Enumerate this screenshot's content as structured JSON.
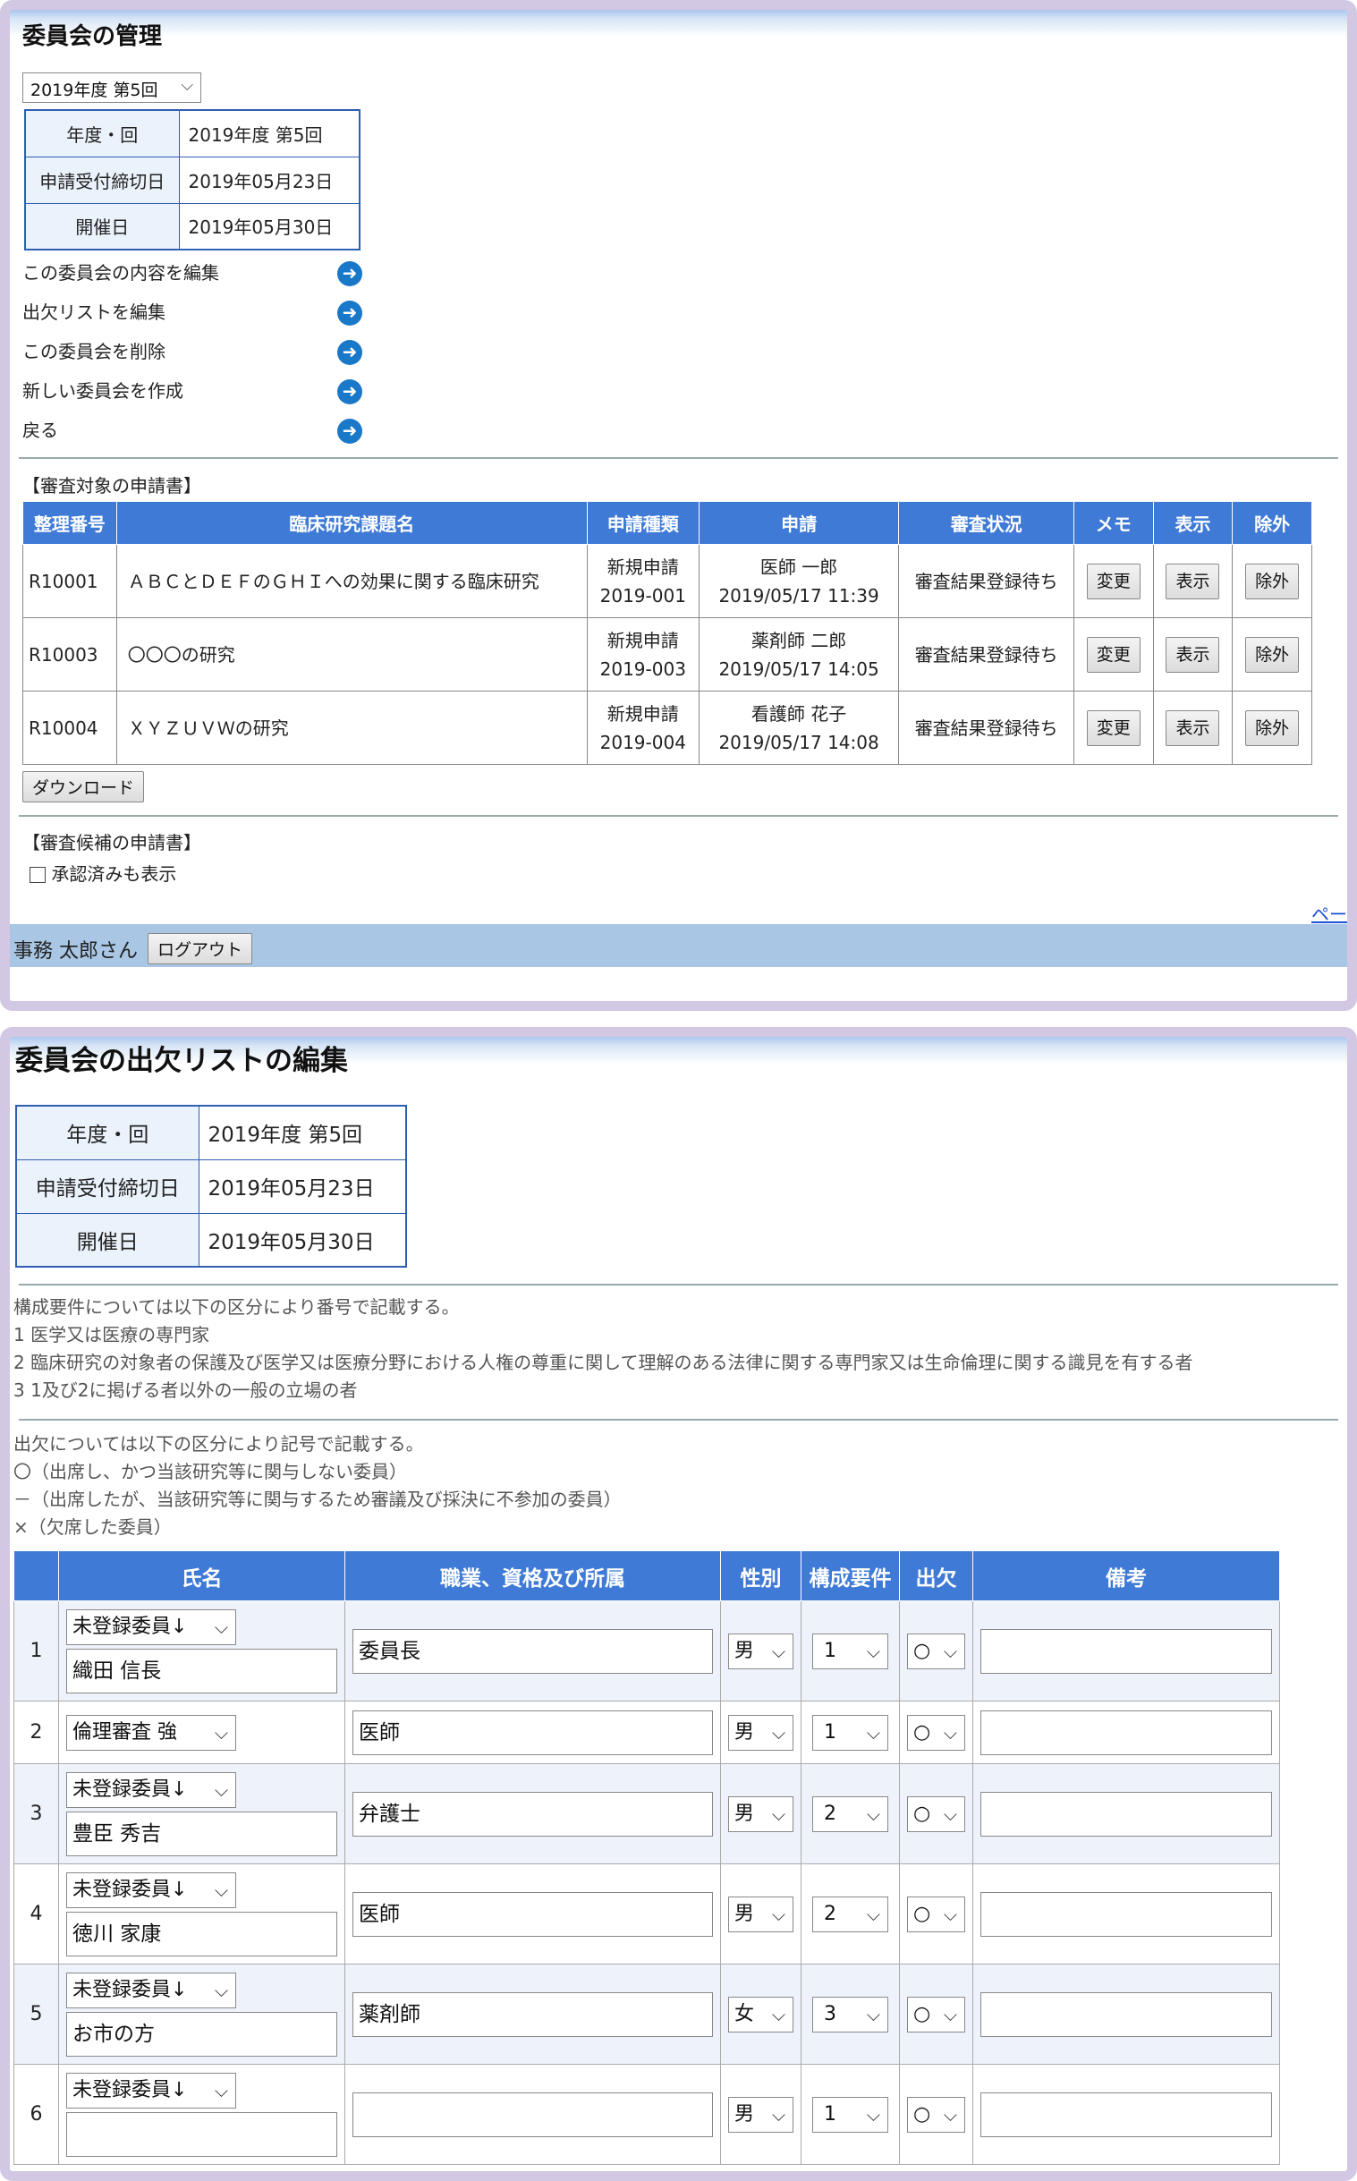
{
  "panel1": {
    "title": "委員会の管理",
    "selector": "2019年度 第5回",
    "info": [
      {
        "label": "年度・回",
        "value": "2019年度 第5回"
      },
      {
        "label": "申請受付締切日",
        "value": "2019年05月23日"
      },
      {
        "label": "開催日",
        "value": "2019年05月30日"
      }
    ],
    "menu": [
      "この委員会の内容を編集",
      "出欠リストを編集",
      "この委員会を削除",
      "新しい委員会を作成",
      "戻る"
    ],
    "review_section": "【審査対象の申請書】",
    "table_headers": [
      "整理番号",
      "臨床研究課題名",
      "申請種類",
      "申請",
      "審査状況",
      "メモ",
      "表示",
      "除外"
    ],
    "rows": [
      {
        "id": "R10001",
        "title": "ＡＢＣとＤＥＦのＧＨＩへの効果に関する臨床研究",
        "type": "新規申請",
        "type_no": "2019-001",
        "applicant": "医師 一郎",
        "date": "2019/05/17 11:39",
        "status": "審査結果登録待ち"
      },
      {
        "id": "R10003",
        "title": "〇〇〇の研究",
        "type": "新規申請",
        "type_no": "2019-003",
        "applicant": "薬剤師 二郎",
        "date": "2019/05/17 14:05",
        "status": "審査結果登録待ち"
      },
      {
        "id": "R10004",
        "title": "ＸＹＺＵＶＷの研究",
        "type": "新規申請",
        "type_no": "2019-004",
        "applicant": "看護師 花子",
        "date": "2019/05/17 14:08",
        "status": "審査結果登録待ち"
      }
    ],
    "btn_change": "変更",
    "btn_show": "表示",
    "btn_exclude": "除外",
    "download": "ダウンロード",
    "candidate_section": "【審査候補の申請書】",
    "checkbox_label": "承認済みも表示",
    "page_link": "ペー",
    "user": "事務 太郎さん",
    "logout": "ログアウト"
  },
  "panel2": {
    "title": "委員会の出欠リストの編集",
    "info": [
      {
        "label": "年度・回",
        "value": "2019年度 第5回"
      },
      {
        "label": "申請受付締切日",
        "value": "2019年05月23日"
      },
      {
        "label": "開催日",
        "value": "2019年05月30日"
      }
    ],
    "notes1": [
      "構成要件については以下の区分により番号で記載する。",
      "1 医学又は医療の専門家",
      "2 臨床研究の対象者の保護及び医学又は医療分野における人権の尊重に関して理解のある法律に関する専門家又は生命倫理に関する識見を有する者",
      "3 1及び2に掲げる者以外の一般の立場の者"
    ],
    "notes2": [
      "出欠については以下の区分により記号で記載する。",
      "〇（出席し、かつ当該研究等に関与しない委員）",
      "－（出席したが、当該研究等に関与するため審議及び採決に不参加の委員）",
      "×（欠席した委員）"
    ],
    "headers": [
      "",
      "氏名",
      "職業、資格及び所属",
      "性別",
      "構成要件",
      "出欠",
      "備考"
    ],
    "members": [
      {
        "no": "1",
        "select": "未登録委員↓",
        "name": "織田 信長",
        "job": "委員長",
        "gender": "男",
        "req": "1",
        "att": "○",
        "remark": ""
      },
      {
        "no": "2",
        "select": "倫理審査 強",
        "name": "",
        "job": "医師",
        "gender": "男",
        "req": "1",
        "att": "○",
        "remark": ""
      },
      {
        "no": "3",
        "select": "未登録委員↓",
        "name": "豊臣 秀吉",
        "job": "弁護士",
        "gender": "男",
        "req": "2",
        "att": "○",
        "remark": ""
      },
      {
        "no": "4",
        "select": "未登録委員↓",
        "name": "徳川 家康",
        "job": "医師",
        "gender": "男",
        "req": "2",
        "att": "○",
        "remark": ""
      },
      {
        "no": "5",
        "select": "未登録委員↓",
        "name": "お市の方",
        "job": "薬剤師",
        "gender": "女",
        "req": "3",
        "att": "○",
        "remark": ""
      },
      {
        "no": "6",
        "select": "未登録委員↓",
        "name": "",
        "job": "",
        "gender": "男",
        "req": "1",
        "att": "○",
        "remark": ""
      }
    ]
  }
}
